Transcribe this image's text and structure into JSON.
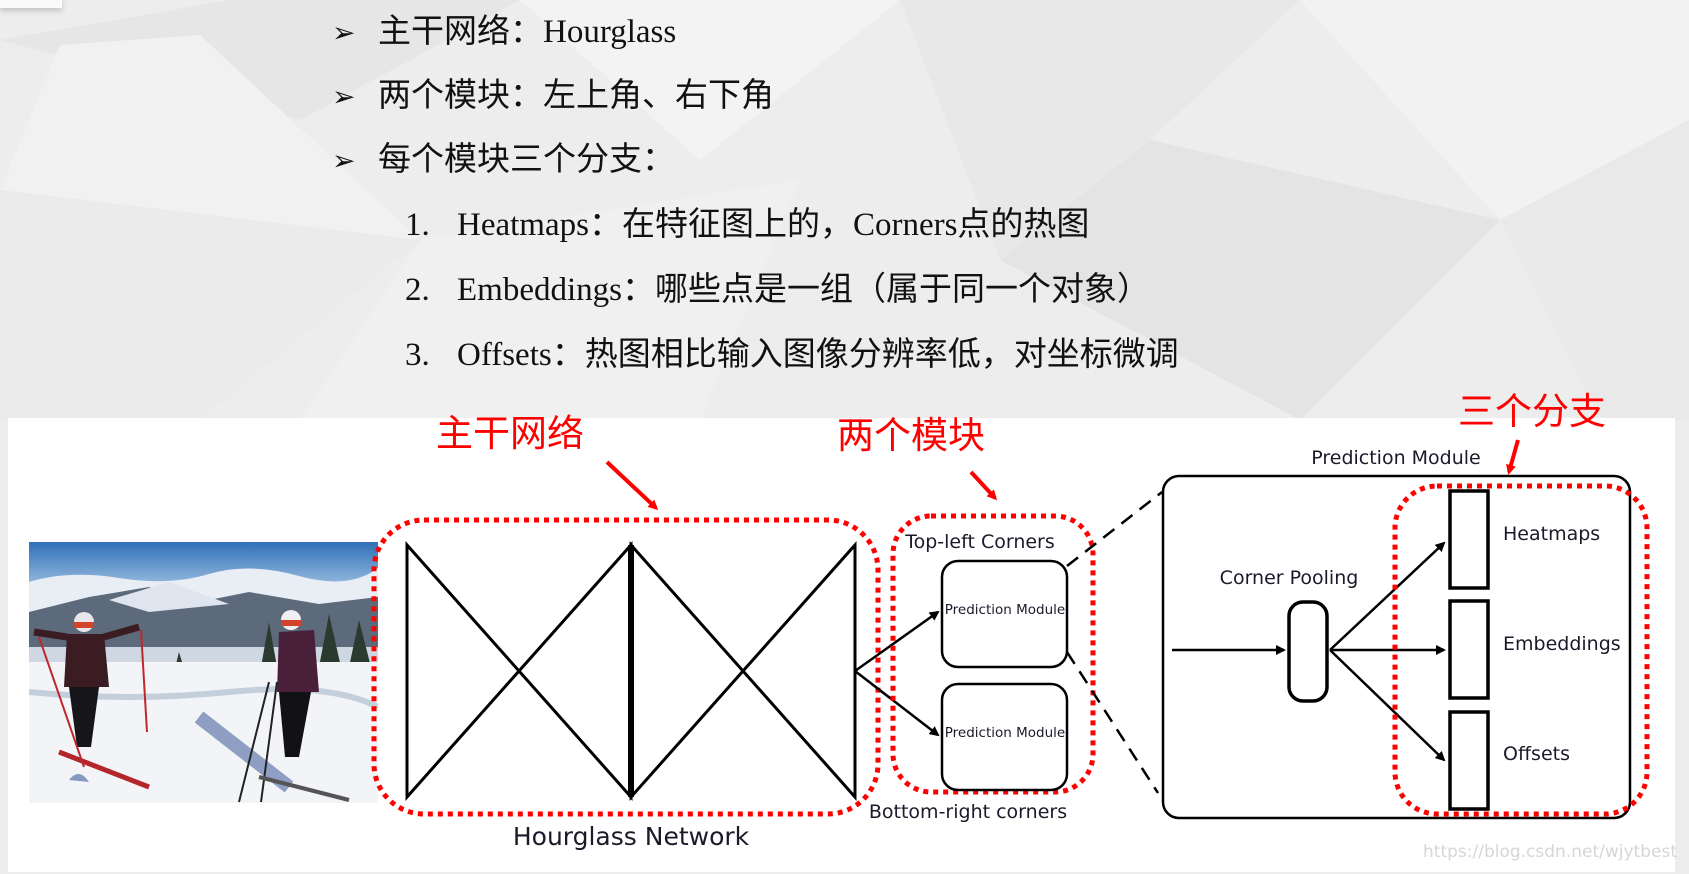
{
  "slide": {
    "bullets": [
      {
        "marker": "➢",
        "text": "主干网络：Hourglass"
      },
      {
        "marker": "➢",
        "text": "两个模块：左上角、右下角"
      },
      {
        "marker": "➢",
        "text": "每个模块三个分支："
      }
    ],
    "numbered": [
      {
        "num": "1.",
        "text": "Heatmaps：在特征图上的，Corners点的热图"
      },
      {
        "num": "2.",
        "text": "Embeddings：哪些点是一组（属于同一个对象）"
      },
      {
        "num": "3.",
        "text": "Offsets：热图相比输入图像分辨率低，对坐标微调"
      }
    ]
  },
  "figure": {
    "annotations": {
      "backbone": "主干网络",
      "two_modules": "两个模块",
      "three_branches": "三个分支"
    },
    "hourglass_label": "Hourglass Network",
    "top_left_label": "Top-left Corners",
    "bottom_right_label": "Bottom-right corners",
    "prediction_module_small_1": "Prediction Module",
    "prediction_module_small_2": "Prediction Module",
    "prediction_module_title": "Prediction Module",
    "corner_pooling_label": "Corner Pooling",
    "outputs": [
      "Heatmaps",
      "Embeddings",
      "Offsets"
    ],
    "photo_alt": "skiers-photo",
    "colors": {
      "annotation": "#ff0000",
      "line": "#000000",
      "label": "#1a1a2a"
    }
  },
  "watermark": "https://blog.csdn.net/wjytbest"
}
